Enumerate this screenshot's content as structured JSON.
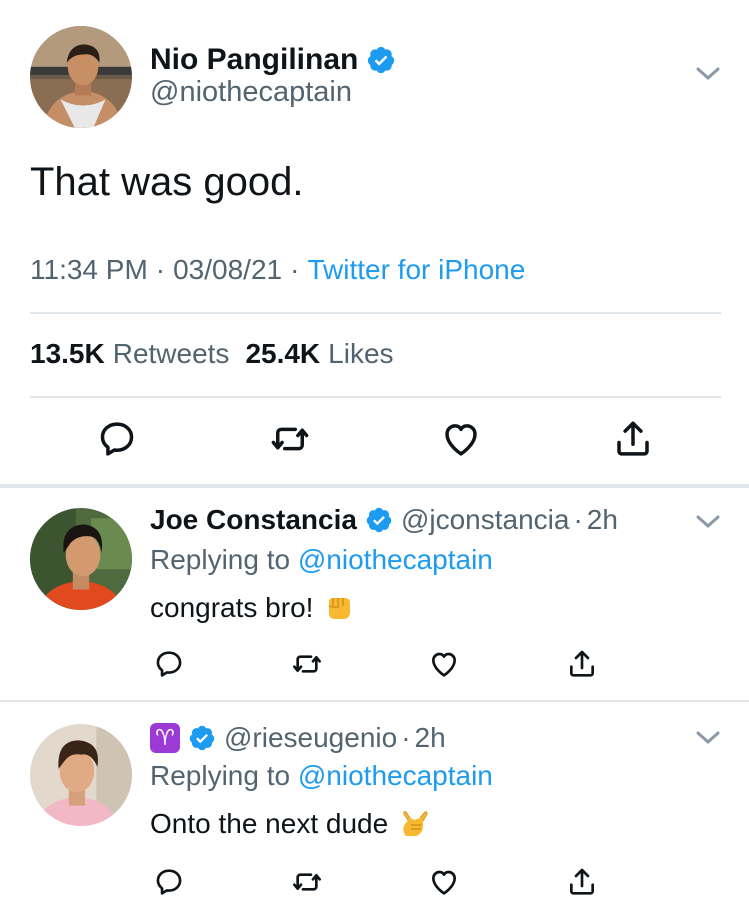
{
  "main_tweet": {
    "author_name": "Nio Pangilinan",
    "author_handle": "@niothecaptain",
    "text": "That was good.",
    "time": "11:34 PM",
    "separator": "·",
    "date": "03/08/21",
    "source": "Twitter for iPhone",
    "retweets_count": "13.5K",
    "retweets_label": "Retweets",
    "likes_count": "25.4K",
    "likes_label": "Likes",
    "icons": {
      "verified": "verified-badge-icon",
      "chevron": "chevron-down-icon",
      "reply": "reply-icon",
      "retweet": "retweet-icon",
      "like": "heart-icon",
      "share": "share-icon"
    }
  },
  "replies": [
    {
      "author_name": "Joe Constancia",
      "author_handle": "@jconstancia",
      "dot": "·",
      "time": "2h",
      "replying_prefix": "Replying to",
      "replying_to": "@niothecaptain",
      "text": "congrats bro!",
      "emoji": "fist-bump-emoji"
    },
    {
      "author_name": "♈",
      "author_handle": "@rieseugenio",
      "dot": "·",
      "time": "2h",
      "replying_prefix": "Replying to",
      "replying_to": "@niothecaptain",
      "text": "Onto the next dude",
      "emoji": "call-me-hand-emoji"
    }
  ],
  "colors": {
    "text": "#0f1419",
    "secondary": "#536471",
    "link": "#1d9bf0",
    "verified": "#1d9bf0",
    "divider": "#e1e6ea",
    "aries_badge": "#9b3ad4"
  }
}
